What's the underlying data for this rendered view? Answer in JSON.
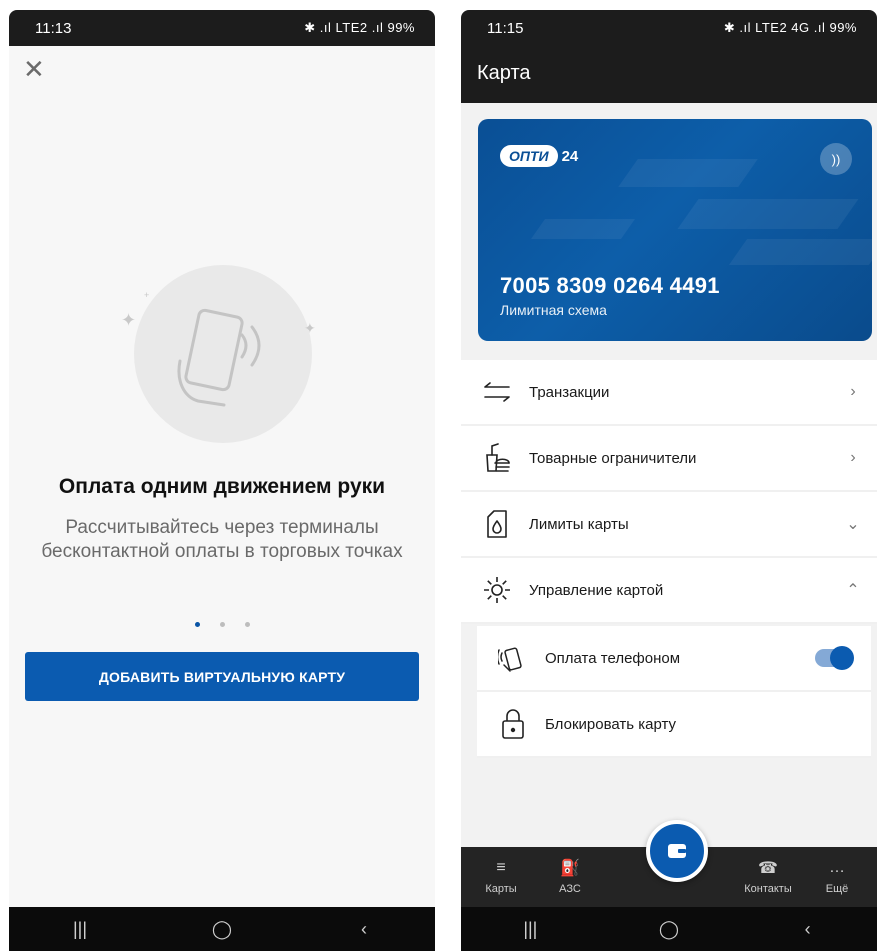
{
  "left_screen": {
    "status": {
      "time": "11:13",
      "right": "✱ .ıl LTE2 .ıl 99%"
    },
    "onboarding": {
      "title": "Оплата одним движением руки",
      "text": "Рассчитывайтесь через терминалы бесконтактной оплаты в торговых точках",
      "page_index": 0,
      "page_count": 3,
      "button_label": "ДОБАВИТЬ ВИРТУАЛЬНУЮ КАРТУ"
    }
  },
  "right_screen": {
    "status": {
      "time": "11:15",
      "right": "✱ .ıl LTE2 4G .ıl 99%"
    },
    "title": "Карта",
    "card": {
      "brand_pill": "ОПТИ",
      "brand_num": "24",
      "number": "7005 8309 0264 4491",
      "scheme": "Лимитная схема",
      "nfc_icon": "))"
    },
    "menu": {
      "items": [
        {
          "label": "Транзакции",
          "icon": "arrows-swap-icon",
          "chevron": "›"
        },
        {
          "label": "Товарные ограничители",
          "icon": "food-icon",
          "chevron": "›"
        },
        {
          "label": "Лимиты карты",
          "icon": "fuel-can-icon",
          "chevron": "⌄"
        },
        {
          "label": "Управление картой",
          "icon": "gear-icon",
          "chevron": "⌃"
        }
      ],
      "sub_items": [
        {
          "label": "Оплата телефоном",
          "icon": "contactless-phone-icon",
          "toggle_on": true
        },
        {
          "label": "Блокировать карту",
          "icon": "lock-icon"
        }
      ]
    },
    "tabbar": {
      "tabs": [
        {
          "label": "Карты",
          "icon": "cards-icon",
          "glyph": "≡"
        },
        {
          "label": "АЗС",
          "icon": "fuel-pump-icon",
          "glyph": "⛽"
        },
        {
          "label": "Контакты",
          "icon": "phone-icon",
          "glyph": "☎"
        },
        {
          "label": "Ещё",
          "icon": "more-icon",
          "glyph": "…"
        }
      ]
    }
  },
  "navbar": {
    "recent": "|||",
    "home": "◯",
    "back": "‹"
  },
  "colors": {
    "primary": "#0b5bb0",
    "card_blue": "#0a4f95",
    "header_dark": "#1c1c1c"
  }
}
